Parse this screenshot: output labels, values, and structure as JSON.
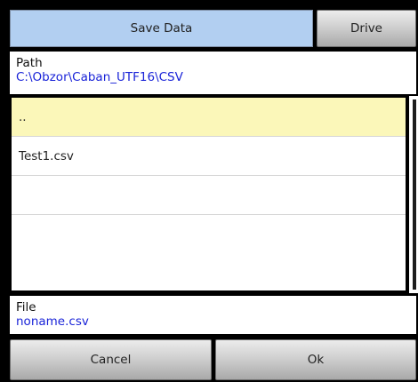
{
  "header": {
    "title": "Save Data",
    "drive_label": "Drive"
  },
  "path": {
    "label": "Path",
    "value": "C:\\Obzor\\Caban_UTF16\\CSV"
  },
  "file_list": [
    {
      "name": "..",
      "selected": true
    },
    {
      "name": "Test1.csv",
      "selected": false
    }
  ],
  "file": {
    "label": "File",
    "value": "noname.csv"
  },
  "footer": {
    "cancel_label": "Cancel",
    "ok_label": "Ok"
  },
  "colors": {
    "title_button": "#b2cff1",
    "selected_row": "#fbf7b9",
    "value_text": "#1a24d8"
  }
}
